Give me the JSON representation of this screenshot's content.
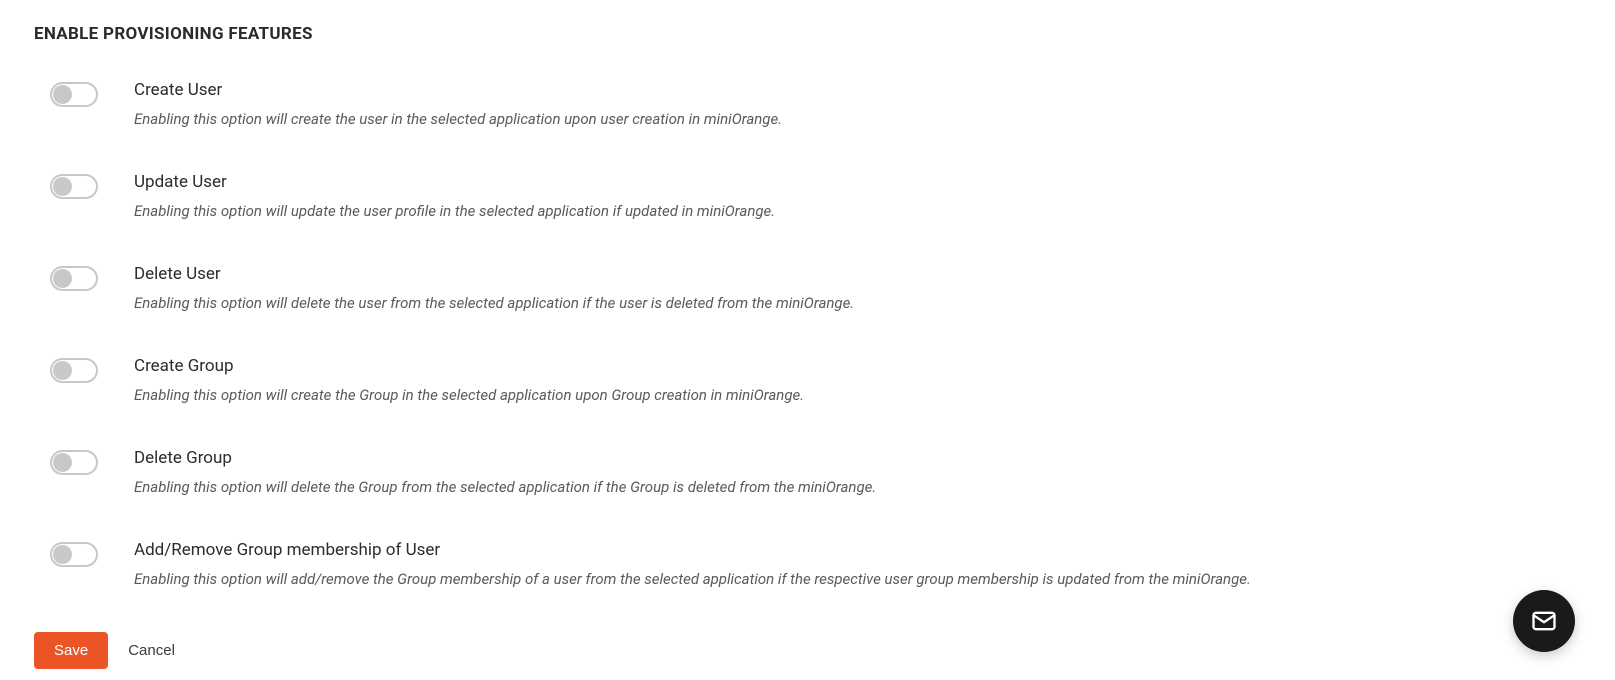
{
  "section": {
    "title": "ENABLE PROVISIONING FEATURES"
  },
  "features": [
    {
      "title": "Create User",
      "description": "Enabling this option will create the user in the selected application upon user creation in miniOrange."
    },
    {
      "title": "Update User",
      "description": "Enabling this option will update the user profile in the selected application if updated in miniOrange."
    },
    {
      "title": "Delete User",
      "description": "Enabling this option will delete the user from the selected application if the user is deleted from the miniOrange."
    },
    {
      "title": "Create Group",
      "description": "Enabling this option will create the Group in the selected application upon Group creation in miniOrange."
    },
    {
      "title": "Delete Group",
      "description": "Enabling this option will delete the Group from the selected application if the Group is deleted from the miniOrange."
    },
    {
      "title": "Add/Remove Group membership of User",
      "description": "Enabling this option will add/remove the Group membership of a user from the selected application if the respective user group membership is updated from the miniOrange."
    }
  ],
  "buttons": {
    "save": "Save",
    "cancel": "Cancel"
  }
}
